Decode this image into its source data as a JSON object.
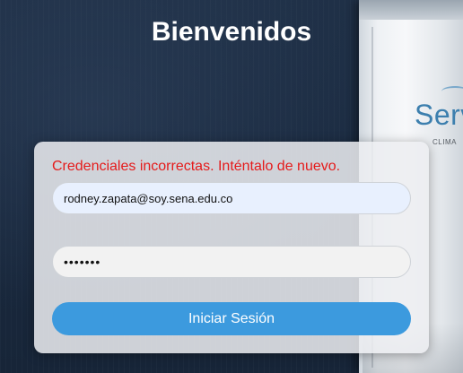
{
  "page": {
    "title": "Bienvenidos"
  },
  "background": {
    "brand_text": "Serv",
    "brand_subtext": "CLIMA"
  },
  "login": {
    "error_message": "Credenciales incorrectas. Inténtalo de nuevo.",
    "email_value": "rodney.zapata@soy.sena.edu.co",
    "password_value": "1234567",
    "submit_label": "Iniciar Sesión"
  },
  "colors": {
    "error": "#e51b1b",
    "button": "#3c9ade",
    "title": "#ffffff"
  }
}
